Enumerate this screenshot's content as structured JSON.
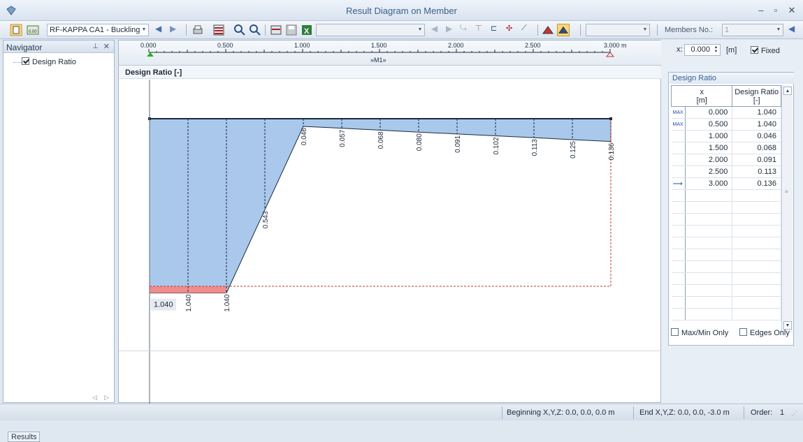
{
  "window": {
    "title": "Result Diagram on Member"
  },
  "toolbar": {
    "case_combo": "RF-KAPPA CA1 - Buckling",
    "members_label": "Members No.:",
    "members_value": "1"
  },
  "navigator": {
    "title": "Navigator",
    "item_label": "Design Ratio",
    "item_checked": true,
    "tab_label": "Results"
  },
  "ruler": {
    "ticks": [
      "0.000",
      "0.500",
      "1.000",
      "1.500",
      "2.000",
      "2.500",
      "3.000 m"
    ],
    "member_label": "»M1»"
  },
  "diagram": {
    "header": "Design Ratio [-]",
    "values": [
      {
        "x": 0.0,
        "ratio": 1.04
      },
      {
        "x": 0.25,
        "ratio": 1.04
      },
      {
        "x": 0.5,
        "ratio": 1.04
      },
      {
        "x": 0.75,
        "ratio": 0.543
      },
      {
        "x": 1.0,
        "ratio": 0.046
      },
      {
        "x": 1.25,
        "ratio": 0.057
      },
      {
        "x": 1.5,
        "ratio": 0.068
      },
      {
        "x": 1.75,
        "ratio": 0.08
      },
      {
        "x": 2.0,
        "ratio": 0.091
      },
      {
        "x": 2.25,
        "ratio": 0.102
      },
      {
        "x": 2.5,
        "ratio": 0.113
      },
      {
        "x": 2.75,
        "ratio": 0.125
      },
      {
        "x": 3.0,
        "ratio": 0.136
      }
    ],
    "value_labels": [
      "1.040",
      "1.040",
      "0.543",
      "0.046",
      "0.057",
      "0.068",
      "0.080",
      "0.091",
      "0.102",
      "0.113",
      "0.125",
      "0.136"
    ],
    "max_label": "1.040",
    "limit_ratio": 1.0
  },
  "position": {
    "x_label": "x:",
    "x_value": "0.000",
    "unit": "[m]",
    "fixed_label": "Fixed",
    "fixed_checked": true
  },
  "results_table": {
    "title": "Design Ratio",
    "col_x": "x",
    "col_x_unit": "[m]",
    "col_ratio": "Design Ratio",
    "col_ratio_unit": "[-]",
    "rows": [
      {
        "marker": "MAX",
        "x": "0.000",
        "ratio": "1.040"
      },
      {
        "marker": "MAX",
        "x": "0.500",
        "ratio": "1.040"
      },
      {
        "marker": "",
        "x": "1.000",
        "ratio": "0.046"
      },
      {
        "marker": "",
        "x": "1.500",
        "ratio": "0.068"
      },
      {
        "marker": "",
        "x": "2.000",
        "ratio": "0.091"
      },
      {
        "marker": "",
        "x": "2.500",
        "ratio": "0.113"
      },
      {
        "marker": "end-arrow",
        "x": "3.000",
        "ratio": "0.136"
      }
    ],
    "maxmin_label": "Max/Min Only",
    "edges_label": "Edges Only"
  },
  "status": {
    "beginning": "Beginning X,Y,Z:  0.0, 0.0, 0.0 m",
    "end": "End X,Y,Z:  0.0, 0.0, -3.0 m",
    "order_label": "Order:",
    "order_value": "1"
  },
  "colors": {
    "fill": "#a9c8ec",
    "exceed": "#f08c8c",
    "limit_line": "#c0392b",
    "title": "#3b5f8c"
  }
}
